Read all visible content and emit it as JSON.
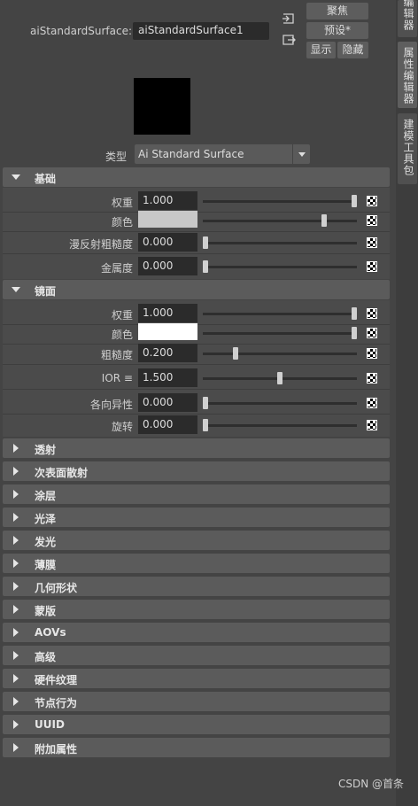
{
  "header": {
    "node_label": "aiStandardSurface:",
    "node_name": "aiStandardSurface1",
    "btn_focus": "聚焦",
    "btn_presets": "预设*",
    "btn_show": "显示",
    "btn_hide": "隐藏"
  },
  "type_row": {
    "label": "类型",
    "value": "Ai Standard Surface"
  },
  "sections": {
    "base": {
      "title": "基础"
    },
    "specular": {
      "title": "镜面"
    },
    "collapsed": [
      "透射",
      "次表面散射",
      "涂层",
      "光泽",
      "发光",
      "薄膜",
      "几何形状",
      "蒙版",
      "AOVs",
      "高级",
      "硬件纹理",
      "节点行为",
      "UUID",
      "附加属性"
    ]
  },
  "base_rows": [
    {
      "label": "权重",
      "value": "1.000",
      "slider": 1.0
    },
    {
      "label": "颜色",
      "color": "#c8c8c8",
      "slider": 0.8
    },
    {
      "label": "漫反射粗糙度",
      "value": "0.000",
      "slider": 0.0
    },
    {
      "label": "金属度",
      "value": "0.000",
      "slider": 0.0
    }
  ],
  "spec_rows": [
    {
      "label": "权重",
      "value": "1.000",
      "slider": 1.0
    },
    {
      "label": "颜色",
      "color": "#ffffff",
      "slider": 1.0
    },
    {
      "label": "粗糙度",
      "value": "0.200",
      "slider": 0.2
    },
    {
      "label": "IOR ≡",
      "value": "1.500",
      "slider": 0.5
    },
    {
      "label": "各向异性",
      "value": "0.000",
      "slider": 0.0
    },
    {
      "label": "旋转",
      "value": "0.000",
      "slider": 0.0
    }
  ],
  "side_tabs": [
    "编辑器",
    "属性编辑器",
    "建模工具包"
  ],
  "watermark": "CSDN @首条"
}
